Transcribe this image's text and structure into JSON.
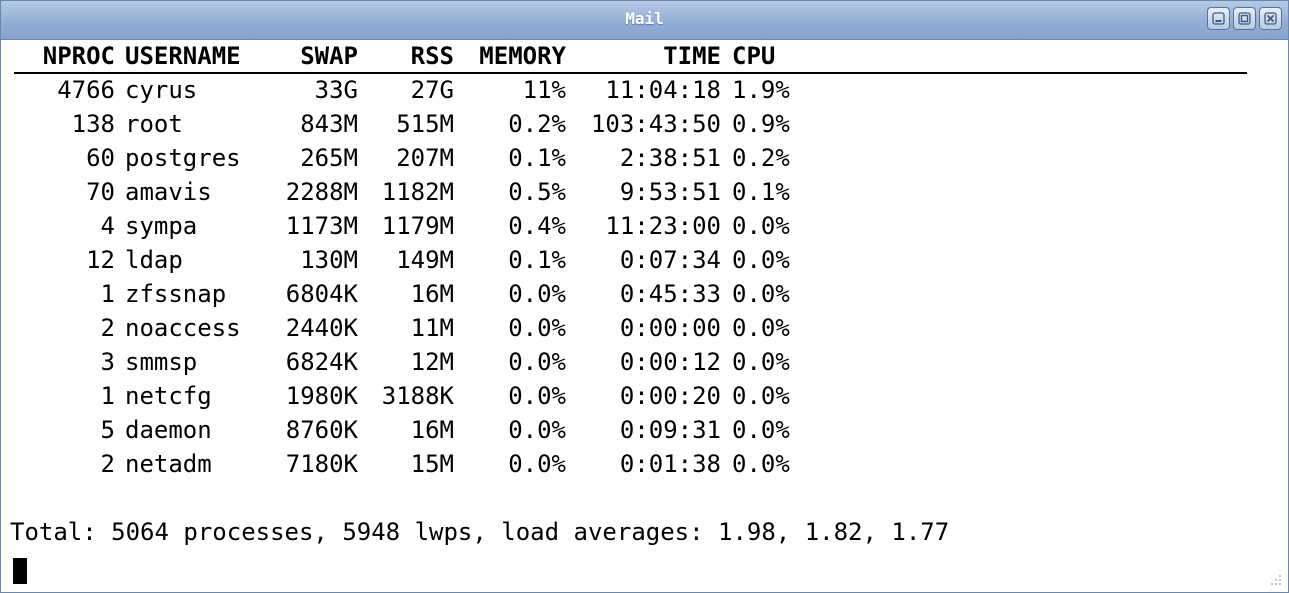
{
  "window": {
    "title": "Mail",
    "buttons": [
      "minimize",
      "maximize",
      "close"
    ]
  },
  "table": {
    "columns": [
      "NPROC",
      "USERNAME",
      "SWAP",
      "RSS",
      "MEMORY",
      "TIME",
      "CPU"
    ],
    "rows": [
      {
        "nproc": "4766",
        "username": "cyrus",
        "swap": "33G",
        "rss": "27G",
        "memory": "11%",
        "time": "11:04:18",
        "cpu": "1.9%"
      },
      {
        "nproc": "138",
        "username": "root",
        "swap": "843M",
        "rss": "515M",
        "memory": "0.2%",
        "time": "103:43:50",
        "cpu": "0.9%"
      },
      {
        "nproc": "60",
        "username": "postgres",
        "swap": "265M",
        "rss": "207M",
        "memory": "0.1%",
        "time": "2:38:51",
        "cpu": "0.2%"
      },
      {
        "nproc": "70",
        "username": "amavis",
        "swap": "2288M",
        "rss": "1182M",
        "memory": "0.5%",
        "time": "9:53:51",
        "cpu": "0.1%"
      },
      {
        "nproc": "4",
        "username": "sympa",
        "swap": "1173M",
        "rss": "1179M",
        "memory": "0.4%",
        "time": "11:23:00",
        "cpu": "0.0%"
      },
      {
        "nproc": "12",
        "username": "ldap",
        "swap": "130M",
        "rss": "149M",
        "memory": "0.1%",
        "time": "0:07:34",
        "cpu": "0.0%"
      },
      {
        "nproc": "1",
        "username": "zfssnap",
        "swap": "6804K",
        "rss": "16M",
        "memory": "0.0%",
        "time": "0:45:33",
        "cpu": "0.0%"
      },
      {
        "nproc": "2",
        "username": "noaccess",
        "swap": "2440K",
        "rss": "11M",
        "memory": "0.0%",
        "time": "0:00:00",
        "cpu": "0.0%"
      },
      {
        "nproc": "3",
        "username": "smmsp",
        "swap": "6824K",
        "rss": "12M",
        "memory": "0.0%",
        "time": "0:00:12",
        "cpu": "0.0%"
      },
      {
        "nproc": "1",
        "username": "netcfg",
        "swap": "1980K",
        "rss": "3188K",
        "memory": "0.0%",
        "time": "0:00:20",
        "cpu": "0.0%"
      },
      {
        "nproc": "5",
        "username": "daemon",
        "swap": "8760K",
        "rss": "16M",
        "memory": "0.0%",
        "time": "0:09:31",
        "cpu": "0.0%"
      },
      {
        "nproc": "2",
        "username": "netadm",
        "swap": "7180K",
        "rss": "15M",
        "memory": "0.0%",
        "time": "0:01:38",
        "cpu": "0.0%"
      }
    ]
  },
  "summary": {
    "text": "Total: 5064 processes, 5948 lwps, load averages: 1.98, 1.82, 1.77"
  },
  "colors": {
    "titlebar": "#93afd6",
    "title_text": "#ffffff",
    "terminal_bg": "#ffffff",
    "terminal_fg": "#000000"
  }
}
